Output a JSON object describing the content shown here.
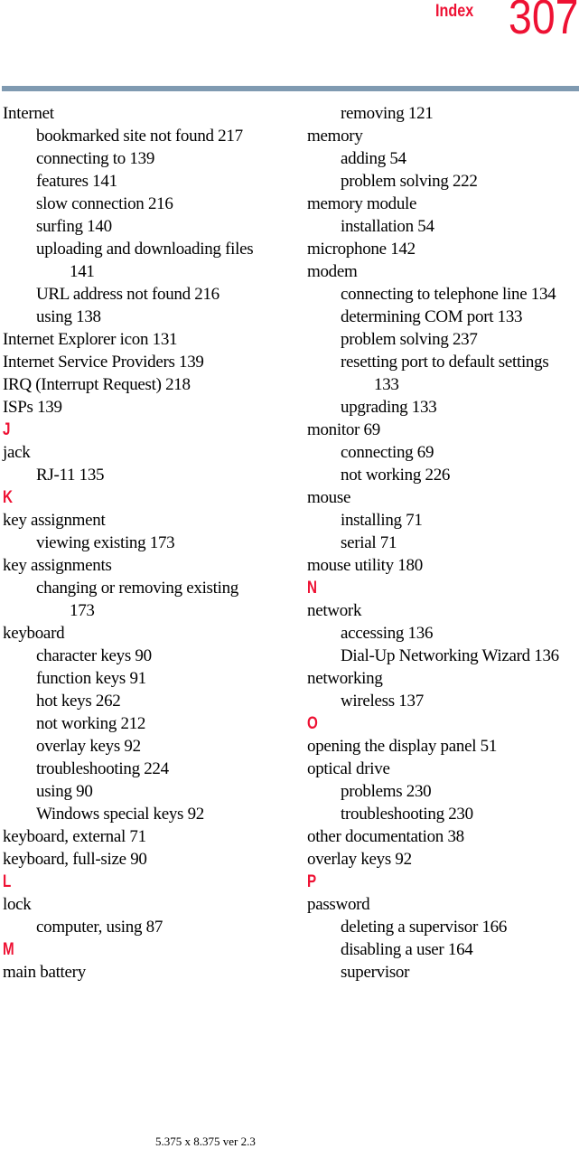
{
  "header": {
    "section_label": "Index",
    "page_number": "307"
  },
  "colors": {
    "accent_red": "#ee1133",
    "rule_blue_gray": "#7f9ab1"
  },
  "left_column": [
    {
      "type": "entry",
      "level": 0,
      "text": "Internet"
    },
    {
      "type": "entry",
      "level": 1,
      "text": "bookmarked site not found 217"
    },
    {
      "type": "entry",
      "level": 1,
      "text": "connecting to 139"
    },
    {
      "type": "entry",
      "level": 1,
      "text": "features 141"
    },
    {
      "type": "entry",
      "level": 1,
      "text": "slow connection 216"
    },
    {
      "type": "entry",
      "level": 1,
      "text": "surfing 140"
    },
    {
      "type": "entry",
      "level": 1,
      "text": "uploading and downloading files"
    },
    {
      "type": "entry",
      "level": 2,
      "text": "141"
    },
    {
      "type": "entry",
      "level": 1,
      "text": "URL address not found 216"
    },
    {
      "type": "entry",
      "level": 1,
      "text": "using 138"
    },
    {
      "type": "entry",
      "level": 0,
      "text": "Internet Explorer icon 131"
    },
    {
      "type": "entry",
      "level": 0,
      "text": "Internet Service Providers 139"
    },
    {
      "type": "entry",
      "level": 0,
      "text": "IRQ (Interrupt Request) 218"
    },
    {
      "type": "entry",
      "level": 0,
      "text": "ISPs 139"
    },
    {
      "type": "letter",
      "level": 0,
      "text": "J"
    },
    {
      "type": "entry",
      "level": 0,
      "text": "jack"
    },
    {
      "type": "entry",
      "level": 1,
      "text": "RJ-11 135"
    },
    {
      "type": "letter",
      "level": 0,
      "text": "K"
    },
    {
      "type": "entry",
      "level": 0,
      "text": "key assignment"
    },
    {
      "type": "entry",
      "level": 1,
      "text": "viewing existing 173"
    },
    {
      "type": "entry",
      "level": 0,
      "text": "key assignments"
    },
    {
      "type": "entry",
      "level": 1,
      "text": "changing or removing existing"
    },
    {
      "type": "entry",
      "level": 2,
      "text": "173"
    },
    {
      "type": "entry",
      "level": 0,
      "text": "keyboard"
    },
    {
      "type": "entry",
      "level": 1,
      "text": "character keys 90"
    },
    {
      "type": "entry",
      "level": 1,
      "text": "function keys 91"
    },
    {
      "type": "entry",
      "level": 1,
      "text": "hot keys 262"
    },
    {
      "type": "entry",
      "level": 1,
      "text": "not working 212"
    },
    {
      "type": "entry",
      "level": 1,
      "text": "overlay keys 92"
    },
    {
      "type": "entry",
      "level": 1,
      "text": "troubleshooting 224"
    },
    {
      "type": "entry",
      "level": 1,
      "text": "using 90"
    },
    {
      "type": "entry",
      "level": 1,
      "text": "Windows special keys 92"
    },
    {
      "type": "entry",
      "level": 0,
      "text": "keyboard, external 71"
    },
    {
      "type": "entry",
      "level": 0,
      "text": "keyboard, full-size 90"
    },
    {
      "type": "letter",
      "level": 0,
      "text": "L"
    },
    {
      "type": "entry",
      "level": 0,
      "text": "lock"
    },
    {
      "type": "entry",
      "level": 1,
      "text": "computer, using 87"
    },
    {
      "type": "letter",
      "level": 0,
      "text": "M"
    },
    {
      "type": "entry",
      "level": 0,
      "text": "main battery"
    }
  ],
  "right_column": [
    {
      "type": "entry",
      "level": 1,
      "text": "removing 121"
    },
    {
      "type": "entry",
      "level": 0,
      "text": "memory"
    },
    {
      "type": "entry",
      "level": 1,
      "text": "adding 54"
    },
    {
      "type": "entry",
      "level": 1,
      "text": "problem solving 222"
    },
    {
      "type": "entry",
      "level": 0,
      "text": "memory module"
    },
    {
      "type": "entry",
      "level": 1,
      "text": "installation 54"
    },
    {
      "type": "entry",
      "level": 0,
      "text": "microphone 142"
    },
    {
      "type": "entry",
      "level": 0,
      "text": "modem"
    },
    {
      "type": "entry",
      "level": 1,
      "text": "connecting to telephone line 134"
    },
    {
      "type": "entry",
      "level": 1,
      "text": "determining COM port 133"
    },
    {
      "type": "entry",
      "level": 1,
      "text": "problem solving 237"
    },
    {
      "type": "entry",
      "level": 1,
      "text": "resetting port to default settings"
    },
    {
      "type": "entry",
      "level": 2,
      "text": "133"
    },
    {
      "type": "entry",
      "level": 1,
      "text": "upgrading 133"
    },
    {
      "type": "entry",
      "level": 0,
      "text": "monitor 69"
    },
    {
      "type": "entry",
      "level": 1,
      "text": "connecting 69"
    },
    {
      "type": "entry",
      "level": 1,
      "text": "not working 226"
    },
    {
      "type": "entry",
      "level": 0,
      "text": "mouse"
    },
    {
      "type": "entry",
      "level": 1,
      "text": "installing 71"
    },
    {
      "type": "entry",
      "level": 1,
      "text": "serial 71"
    },
    {
      "type": "entry",
      "level": 0,
      "text": "mouse utility 180"
    },
    {
      "type": "letter",
      "level": 0,
      "text": "N"
    },
    {
      "type": "entry",
      "level": 0,
      "text": "network"
    },
    {
      "type": "entry",
      "level": 1,
      "text": "accessing 136"
    },
    {
      "type": "entry",
      "level": 1,
      "text": "Dial-Up Networking Wizard 136"
    },
    {
      "type": "entry",
      "level": 0,
      "text": "networking"
    },
    {
      "type": "entry",
      "level": 1,
      "text": "wireless 137"
    },
    {
      "type": "letter",
      "level": 0,
      "text": "O"
    },
    {
      "type": "entry",
      "level": 0,
      "text": "opening the display panel 51"
    },
    {
      "type": "entry",
      "level": 0,
      "text": "optical drive"
    },
    {
      "type": "entry",
      "level": 1,
      "text": "problems 230"
    },
    {
      "type": "entry",
      "level": 1,
      "text": "troubleshooting 230"
    },
    {
      "type": "entry",
      "level": 0,
      "text": "other documentation 38"
    },
    {
      "type": "entry",
      "level": 0,
      "text": "overlay keys 92"
    },
    {
      "type": "letter",
      "level": 0,
      "text": "P"
    },
    {
      "type": "entry",
      "level": 0,
      "text": "password"
    },
    {
      "type": "entry",
      "level": 1,
      "text": "deleting a supervisor 166"
    },
    {
      "type": "entry",
      "level": 1,
      "text": "disabling a user 164"
    },
    {
      "type": "entry",
      "level": 1,
      "text": "supervisor"
    }
  ],
  "footer": {
    "text": "5.375 x 8.375 ver 2.3"
  }
}
